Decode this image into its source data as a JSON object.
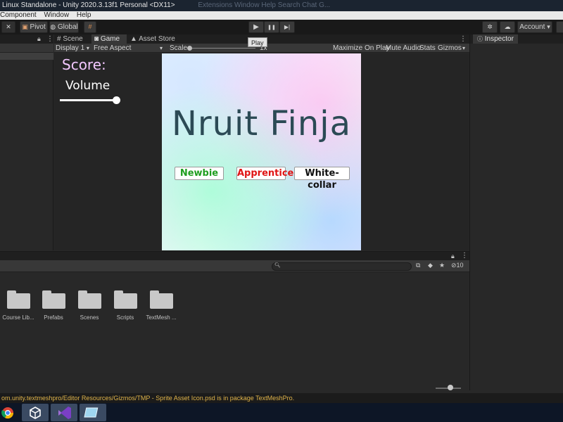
{
  "window": {
    "title": "Linux Standalone - Unity 2020.3.13f1 Personal <DX11>",
    "ghost_text": "Extensions   Window   Help   Search Chat G..."
  },
  "menubar": {
    "items": [
      "Component",
      "Window",
      "Help"
    ]
  },
  "toolbar": {
    "pivot_label": "Pivot",
    "global_label": "Global",
    "play_icon": "▶",
    "pause_icon": "❚❚",
    "step_icon": "▶|",
    "account_label": "Account",
    "play_tooltip": "Play"
  },
  "scene_tabs": [
    {
      "label": "Scene",
      "icon": "#"
    },
    {
      "label": "Game",
      "icon": "◙"
    },
    {
      "label": "Asset Store",
      "icon": "▲"
    }
  ],
  "gamebar": {
    "display": "Display 1",
    "aspect": "Free Aspect",
    "scale_label": "Scale",
    "scale_value": "1x",
    "maximize": "Maximize On Play",
    "mute": "Mute Audio",
    "stats": "Stats",
    "gizmos": "Gizmos"
  },
  "game": {
    "score_label": "Score:",
    "volume_label": "Volume",
    "title": "Nruit Finja",
    "buttons": [
      {
        "label": "Newbie",
        "color": "#1f9e1f"
      },
      {
        "label": "Apprentice",
        "color": "#e01414"
      },
      {
        "label": "White-collar",
        "color": "#111111"
      }
    ]
  },
  "inspector": {
    "tab_label": "Inspector"
  },
  "project": {
    "hidden_count": "10",
    "folders": [
      "Course Lib...",
      "Prefabs",
      "Scenes",
      "Scripts",
      "TextMesh ..."
    ]
  },
  "status": {
    "message": "om.unity.textmeshpro/Editor Resources/Gizmos/TMP - Sprite Asset Icon.psd is in package TextMeshPro."
  }
}
